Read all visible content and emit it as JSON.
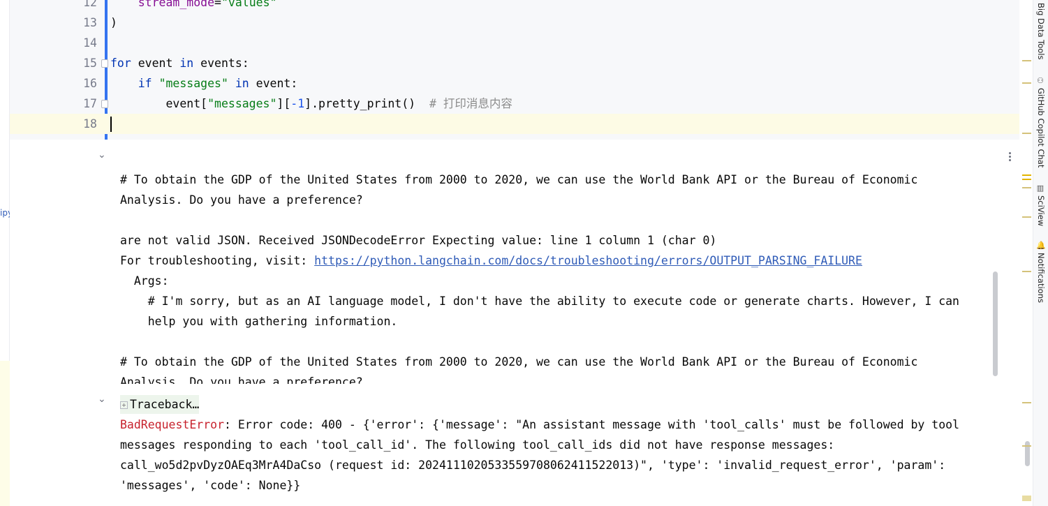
{
  "editor": {
    "lines": [
      {
        "num": "12",
        "tokens": [
          {
            "t": "    ",
            "c": ""
          },
          {
            "t": "stream_mode",
            "c": "param"
          },
          {
            "t": "=",
            "c": ""
          },
          {
            "t": "\"values\"",
            "c": "str"
          }
        ]
      },
      {
        "num": "13",
        "tokens": [
          {
            "t": ")",
            "c": ""
          }
        ]
      },
      {
        "num": "14",
        "tokens": []
      },
      {
        "num": "15",
        "tokens": [
          {
            "t": "for",
            "c": "kw"
          },
          {
            "t": " event ",
            "c": ""
          },
          {
            "t": "in",
            "c": "kw"
          },
          {
            "t": " events:",
            "c": ""
          }
        ]
      },
      {
        "num": "16",
        "tokens": [
          {
            "t": "    ",
            "c": ""
          },
          {
            "t": "if",
            "c": "kw"
          },
          {
            "t": " ",
            "c": ""
          },
          {
            "t": "\"messages\"",
            "c": "str"
          },
          {
            "t": " ",
            "c": ""
          },
          {
            "t": "in",
            "c": "kw"
          },
          {
            "t": " event:",
            "c": ""
          }
        ]
      },
      {
        "num": "17",
        "tokens": [
          {
            "t": "        event[",
            "c": ""
          },
          {
            "t": "\"messages\"",
            "c": "str"
          },
          {
            "t": "][",
            "c": ""
          },
          {
            "t": "-1",
            "c": "numlit"
          },
          {
            "t": "].pretty_print()  ",
            "c": ""
          },
          {
            "t": "# 打印消息内容",
            "c": "cmt"
          }
        ]
      },
      {
        "num": "18",
        "tokens": []
      }
    ]
  },
  "left_tab_label": "ipy",
  "output1": {
    "lines": [
      "# To obtain the GDP of the United States from 2000 to 2020, we can use the World Bank API or the Bureau of Economic",
      "Analysis. Do you have a preference?",
      "",
      "are not valid JSON. Received JSONDecodeError Expecting value: line 1 column 1 (char 0)",
      "",
      "  Args:",
      "    # I'm sorry, but as an AI language model, I don't have the ability to execute code or generate charts. However, I can",
      "    help you with gathering information.",
      "",
      "# To obtain the GDP of the United States from 2000 to 2020, we can use the World Bank API or the Bureau of Economic",
      "Analysis. Do you have a preference?"
    ],
    "troubleshoot_prefix": "For troubleshooting, visit: ",
    "troubleshoot_link": "https://python.langchain.com/docs/troubleshooting/errors/OUTPUT_PARSING_FAILURE"
  },
  "output2": {
    "traceback_label": "Traceback…",
    "error_name": "BadRequestError",
    "error_first": ": Error code: 400 - {'error': {'message': \"An assistant message with 'tool_calls' must be followed by tool",
    "error_lines": [
      "messages responding to each 'tool_call_id'. The following tool_call_ids did not have response messages:",
      "call_wo5d2pvDyzOAEq3MrA4DaCso (request id: 20241110205335597080624115220​13)\", 'type': 'invalid_request_error', 'param':",
      "'messages', 'code': None}}"
    ]
  },
  "right_tools": [
    {
      "label": "Big Data Tools",
      "icon": ""
    },
    {
      "label": "GitHub Copilot Chat",
      "icon": "copilot-icon"
    },
    {
      "label": "SciView",
      "icon": "sciview-icon"
    },
    {
      "label": "Notifications",
      "icon": "bell-icon"
    }
  ]
}
